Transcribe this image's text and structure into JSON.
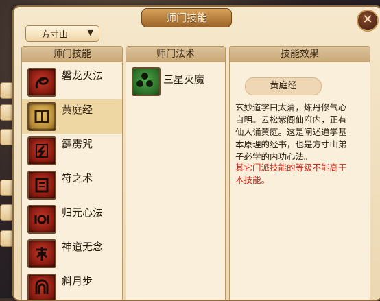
{
  "window": {
    "title": "师门技能",
    "close_icon": "close-icon"
  },
  "school_select": {
    "value": "方寸山"
  },
  "skills_panel": {
    "header": "师门技能",
    "items": [
      {
        "label": "磐龙灭法",
        "icon": "dragon-glyph-icon"
      },
      {
        "label": "黄庭经",
        "icon": "scroll-book-icon",
        "selected": true
      },
      {
        "label": "霹雳咒",
        "icon": "lightning-glyph-icon"
      },
      {
        "label": "符之术",
        "icon": "talisman-glyph-icon"
      },
      {
        "label": "归元心法",
        "icon": "return-origin-glyph-icon"
      },
      {
        "label": "神道无念",
        "icon": "spirit-path-glyph-icon"
      },
      {
        "label": "斜月步",
        "icon": "moon-step-glyph-icon"
      }
    ]
  },
  "magic_panel": {
    "header": "师门法术",
    "items": [
      {
        "label": "三星灭魔",
        "icon": "three-stars-icon"
      }
    ]
  },
  "effect_panel": {
    "header": "技能效果",
    "skill_name": "黄庭经",
    "lines": [
      "玄妙道学曰太清，炼丹修气心",
      "自明。云松紫阁仙府内，正有",
      "仙人诵黄庭。这是阐述道学基",
      "本原理的经书，也是方寸山弟",
      "子必学的内功心法。"
    ],
    "warning_lines": [
      "其它门派技能的等级不能高于",
      "本技能。"
    ]
  },
  "colors": {
    "warning": "#d12418",
    "selected_row": "#efd7a3",
    "frame": "#8f6a3c"
  }
}
